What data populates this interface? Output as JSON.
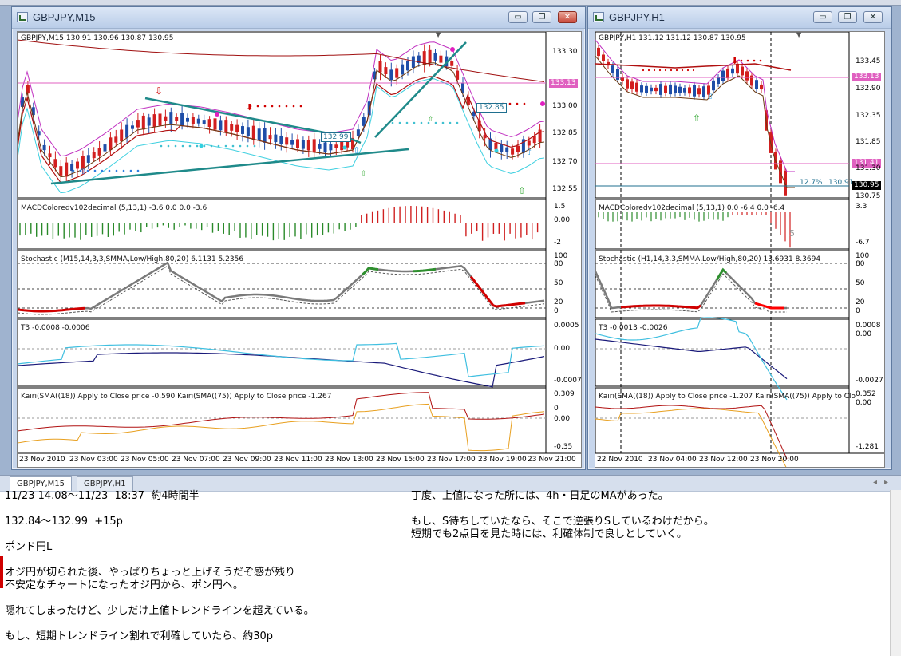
{
  "windows": [
    {
      "id": "m15",
      "caption": "GBPJPY,M15",
      "buttons": {
        "min": "▭",
        "max": "❐",
        "close": "✕"
      },
      "main": {
        "header": "GBPJPY,M15  130.91 130.96 130.87 130.95",
        "price_labels": [
          "133.30",
          "133.15",
          "133.00",
          "132.85",
          "132.70",
          "132.55"
        ],
        "current_price": "133.13",
        "box_price": "132.85",
        "box_price2": "132.99"
      },
      "macd": {
        "header": "MACDColoredv102decimal (5,13,1) -3.6 0.0 0.0 -3.6",
        "labels": [
          "1.5",
          "0.00",
          "-2"
        ]
      },
      "stoch": {
        "header": "Stochastic (M15,14,3,3,SMMA,Low/High,80,20) 6.1131 5.2356",
        "labels": [
          "100",
          "80",
          "50",
          "20",
          "0"
        ]
      },
      "t3": {
        "header": "T3 -0.0008 -0.0006",
        "labels": [
          "0.0005",
          "0.00",
          "-0.0007"
        ]
      },
      "kairi": {
        "header": "Kairi(SMA((18)) Apply to Close price -0.590  Kairi(SMA((75)) Apply to Close price -1.267",
        "labels": [
          "0.309",
          "0",
          "0.00",
          "-0.35"
        ]
      },
      "time_axis": [
        "23 Nov 2010",
        "23 Nov 03:00",
        "23 Nov 05:00",
        "23 Nov 07:00",
        "23 Nov 09:00",
        "23 Nov 11:00",
        "23 Nov 13:00",
        "23 Nov 15:00",
        "23 Nov 17:00",
        "23 Nov 19:00",
        "23 Nov 21:00"
      ]
    },
    {
      "id": "h1",
      "caption": "GBPJPY,H1",
      "buttons": {
        "min": "▭",
        "max": "❐",
        "close": "✕"
      },
      "main": {
        "header": "GBPJPY,H1  131.12 131.12 130.87 130.95",
        "price_labels": [
          "133.45",
          "132.90",
          "132.35",
          "131.85",
          "131.30"
        ],
        "current_price": "133.13",
        "fib_price": "131.41",
        "last_price": "130.95",
        "fib_label": "12.7%",
        "fib_value": "130.91"
      },
      "macd": {
        "header": "MACDColoredv102decimal (5,13,1) 0.0 -6.4 0.0 -6.4",
        "labels": [
          "3.3",
          "-6.7"
        ],
        "marker": "5"
      },
      "stoch": {
        "header": "Stochastic (H1,14,3,3,SMMA,Low/High,80,20) 13.6931 8.3694",
        "labels": [
          "100",
          "80",
          "50",
          "20",
          "0"
        ]
      },
      "t3": {
        "header": "T3 -0.0013 -0.0026",
        "labels": [
          "0.0008",
          "0.00",
          "-0.0027"
        ]
      },
      "kairi": {
        "header": "Kairi(SMA((18)) Apply to Close price -1.207  Kairi(SMA((75)) Apply to Close price",
        "labels": [
          "0.352",
          "0.00",
          "-1.281"
        ]
      },
      "time_axis": [
        "22 Nov 2010",
        "23 Nov 04:00",
        "23 Nov 12:00",
        "23 Nov 20:00"
      ]
    }
  ],
  "tabs": [
    {
      "label": "GBPJPY,M15",
      "active": true
    },
    {
      "label": "GBPJPY,H1",
      "active": false
    }
  ],
  "notes_left": [
    "11/23 14.08〜11/23  18:37  約4時間半",
    "",
    "132.84〜132.99  +15p",
    "",
    "ポンド円L",
    "",
    "オジ円が切られた後、やっぱりちょっと上げそうだぞ感が残り",
    "不安定なチャートになったオジ円から、ポン円へ。",
    "",
    "隠れてしまったけど、少しだけ上値トレンドラインを超えている。",
    "",
    "もし、短期トレンドライン割れで利確していたら、約30p"
  ],
  "notes_right": [
    "丁度、上値になった所には、4h・日足のMAがあった。",
    "",
    "もし、S待ちしていたなら、そこで逆張りSしているわけだから。",
    "短期でも2点目を見た時には、利確体制で良しとしていく。"
  ],
  "colors": {
    "bull": "#1f4ea8",
    "bear": "#d21f1f",
    "stoch_main": "#7a7a7a",
    "stoch_low": "#d00000",
    "stoch_high": "#2f8f2f",
    "t3_a": "#1a1a7a",
    "t3_b": "#3fbfe0",
    "kairi_a": "#b01010",
    "kairi_b": "#e8a020",
    "price_line": "#e060c0",
    "ma_red": "#b01010",
    "trend": "#1f8a8a"
  }
}
